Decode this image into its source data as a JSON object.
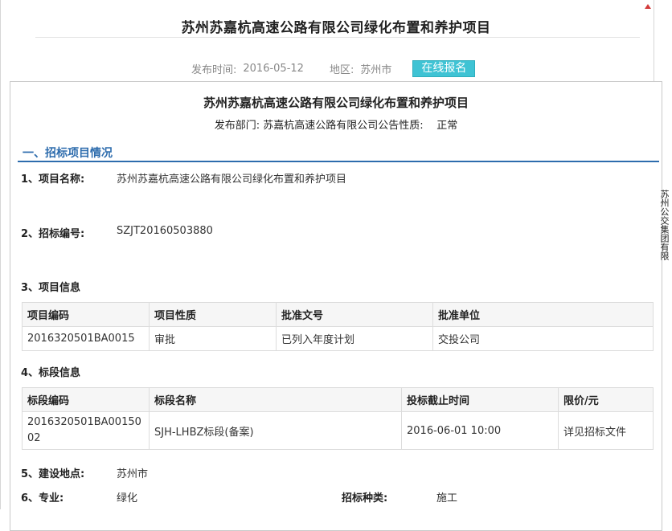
{
  "page": {
    "title": "苏州苏嘉杭高速公路有限公司绿化布置和养护项目",
    "publish_time_label": "发布时间:",
    "publish_time": "2016-05-12",
    "region_label": "地区:",
    "region": "苏州市",
    "signup_button": "在线报名"
  },
  "detail": {
    "title": "苏州苏嘉杭高速公路有限公司绿化布置和养护项目",
    "subtitle": "发布部门: 苏嘉杭高速公路有限公司公告性质:    正常",
    "section_title": "一、招标项目情况",
    "project_name_label": "1、项目名称:",
    "project_name": "苏州苏嘉杭高速公路有限公司绿化布置和养护项目",
    "tender_no_label": "2、招标编号:",
    "tender_no": "SZJT20160503880",
    "project_info_label": "3、项目信息",
    "project_table": {
      "headers": [
        "项目编码",
        "项目性质",
        "批准文号",
        "批准单位"
      ],
      "rows": [
        [
          "2016320501BA0015",
          "审批",
          "已列入年度计划",
          "交投公司"
        ]
      ]
    },
    "lot_info_label": "4、标段信息",
    "lot_table": {
      "headers": [
        "标段编码",
        "标段名称",
        "投标截止时间",
        "限价/元"
      ],
      "rows": [
        [
          "2016320501BA0015002",
          "SJH-LHBZ标段(备案)",
          "2016-06-01 10:00",
          "详见招标文件"
        ]
      ]
    },
    "location_label": "5、建设地点:",
    "location": "苏州市",
    "specialty_label": "6、专业:",
    "specialty": "绿化",
    "bid_type_label": "招标种类:",
    "bid_type": "施工"
  },
  "side_text": "苏州公交集团有限公司SZ"
}
